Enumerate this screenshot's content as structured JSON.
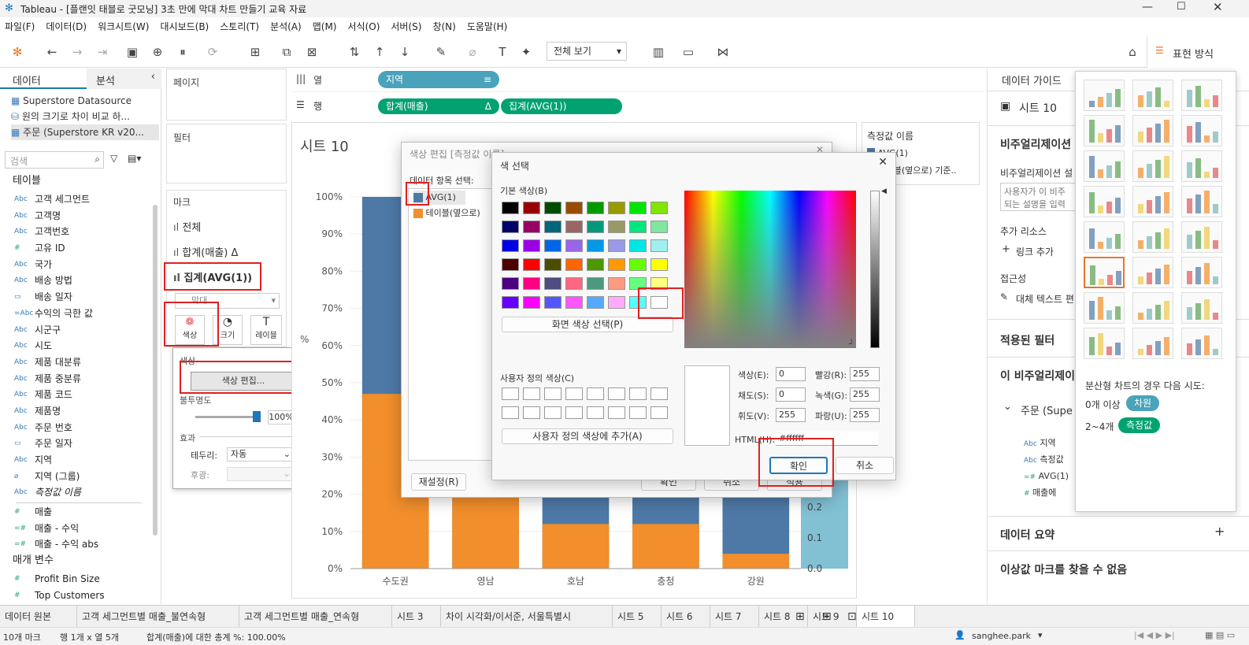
{
  "window": {
    "title": "Tableau - [플랜잇 태블로 굿모닝] 3초 만에 막대 차트 만들기 교육 자료"
  },
  "menu": [
    "파일(F)",
    "데이터(D)",
    "워크시트(W)",
    "대시보드(B)",
    "스토리(T)",
    "분석(A)",
    "맵(M)",
    "서식(O)",
    "서버(S)",
    "창(N)",
    "도움말(H)"
  ],
  "toolbar": {
    "view_dropdown": "전체 보기",
    "show_me_label": "표현 방식"
  },
  "left": {
    "tab_data": "데이터",
    "tab_analysis": "분석",
    "sources": [
      "Superstore Datasource",
      "원의 크기로 차이 비교 하...",
      "주문 (Superstore KR v20..."
    ],
    "search_placeholder": "검색",
    "tables_header": "테이블",
    "fields": [
      {
        "type": "Abc",
        "name": "고객 세그먼트"
      },
      {
        "type": "Abc",
        "name": "고객명"
      },
      {
        "type": "Abc",
        "name": "고객번호"
      },
      {
        "type": "#",
        "name": "고유 ID"
      },
      {
        "type": "Abc",
        "name": "국가"
      },
      {
        "type": "Abc",
        "name": "배송 방법"
      },
      {
        "type": "▭",
        "name": "배송 일자"
      },
      {
        "type": "=Abc",
        "name": "수익의 극한 값"
      },
      {
        "type": "Abc",
        "name": "시군구"
      },
      {
        "type": "Abc",
        "name": "시도"
      },
      {
        "type": "Abc",
        "name": "제품 대분류"
      },
      {
        "type": "Abc",
        "name": "제품 중분류"
      },
      {
        "type": "Abc",
        "name": "제품 코드"
      },
      {
        "type": "Abc",
        "name": "제품명"
      },
      {
        "type": "Abc",
        "name": "주문 번호"
      },
      {
        "type": "▭",
        "name": "주문 일자"
      },
      {
        "type": "Abc",
        "name": "지역"
      },
      {
        "type": "⌀",
        "name": "지역 (그룹)"
      },
      {
        "type": "Abc",
        "name": "측정값 이름"
      }
    ],
    "measures": [
      {
        "type": "#",
        "name": "매출"
      },
      {
        "type": "=#",
        "name": "매출 - 수익"
      },
      {
        "type": "=#",
        "name": "매출 - 수익 abs"
      }
    ],
    "params_header": "매개 변수",
    "params": [
      {
        "type": "#",
        "name": "Profit Bin Size"
      },
      {
        "type": "#",
        "name": "Top Customers"
      }
    ]
  },
  "cards": {
    "pages": "페이지",
    "filters": "필터",
    "marks": "마크",
    "marks_items": [
      "전체",
      "합계(매출) Δ",
      "집계(AVG(1))"
    ],
    "mark_type": "막대",
    "mark_buttons": [
      "색상",
      "크기",
      "레이블"
    ],
    "color_popup": {
      "section": "색상",
      "edit_button": "색상 편집...",
      "opacity_label": "불투명도",
      "opacity_value": "100%",
      "effects": "효과",
      "border_label": "테두리:",
      "border_value": "자동",
      "halo_label": "후광:"
    }
  },
  "shelves": {
    "columns_label": "열",
    "rows_label": "행",
    "columns_pill": "지역",
    "rows_pills": [
      "합계(매출)",
      "집계(AVG(1))"
    ]
  },
  "sheet": {
    "title": "시트 10"
  },
  "chart_data": {
    "type": "bar",
    "categories": [
      "수도권",
      "영남",
      "호남",
      "충청",
      "강원"
    ],
    "series": [
      {
        "name": "AVG(1)",
        "values": [
          1.0,
          1.0,
          1.0,
          1.0,
          1.0
        ]
      },
      {
        "name": "테이블(옆으로) 기준...",
        "values": [
          0.47,
          0.26,
          0.12,
          0.12,
          0.04
        ]
      }
    ],
    "ylim": [
      0,
      1
    ],
    "y_ticks": [
      "0%",
      "10%",
      "20%",
      "30%",
      "40%",
      "50%",
      "60%",
      "70%",
      "80%",
      "90%",
      "100%"
    ],
    "ylabel": "%",
    "right_ticks": [
      "0.0",
      "0.1",
      "0.2"
    ],
    "colors": {
      "blue": "#4e79a7",
      "orange": "#f28e2b",
      "axis_band": "#82c0d4"
    }
  },
  "legend": {
    "title": "측정값 이름",
    "items": [
      "AVG(1)",
      "테이블(옆으로) 기준.."
    ]
  },
  "edit_colors_dialog": {
    "title": "색상 편집 [측정값 이름]",
    "select_label": "데이터 항목 선택:",
    "items": [
      "AVG(1)",
      "테이블(옆으로)"
    ],
    "reset": "재설정(R)",
    "ok": "확인",
    "cancel": "취소",
    "apply": "적용"
  },
  "color_picker": {
    "title": "색 선택",
    "basic_label": "기본 색상(B)",
    "pick_screen": "화면 색상 선택(P)",
    "custom_label": "사용자 정의 색상(C)",
    "add_custom": "사용자 정의 색상에 추가(A)",
    "hue_label": "색상(E):",
    "hue": "0",
    "sat_label": "채도(S):",
    "sat": "0",
    "lum_label": "휘도(V):",
    "lum": "255",
    "red_label": "빨강(R):",
    "red": "255",
    "green_label": "녹색(G):",
    "green": "255",
    "blue_label": "파랑(U):",
    "blue": "255",
    "html_label": "HTML(H):",
    "html": "#ffffff",
    "ok": "확인",
    "cancel": "취소",
    "swatches": [
      "#000000",
      "#990000",
      "#004d00",
      "#994c00",
      "#009900",
      "#999900",
      "#00e600",
      "#80e600",
      "#000066",
      "#990066",
      "#00667a",
      "#996666",
      "#00997a",
      "#999966",
      "#00e680",
      "#80e6a0",
      "#0000e6",
      "#9900e6",
      "#0066e6",
      "#9966e6",
      "#0099e6",
      "#9999e6",
      "#00e6e6",
      "#a0f0f0",
      "#4d0000",
      "#ff0000",
      "#4d4d00",
      "#ff6600",
      "#4d9900",
      "#ff9900",
      "#66ff00",
      "#ffff00",
      "#4d0080",
      "#ff0080",
      "#4d4d80",
      "#ff6680",
      "#4d9980",
      "#ff9980",
      "#66ff80",
      "#ffff80",
      "#6600ff",
      "#ff00ff",
      "#5555ff",
      "#ff55ff",
      "#55aaff",
      "#ffaaff",
      "#55ffff",
      "#ffffff"
    ]
  },
  "right": {
    "data_guide": "데이터 가이드",
    "sheet": "시트 10",
    "viz_header": "비주얼리제이션",
    "viz_desc_label": "비주얼리제이션 설",
    "viz_desc_placeholder": "사용자가 이 비주 되는 설명을 입력",
    "resources": "추가 리소스",
    "add_link": "링크 추가",
    "accessibility": "접근성",
    "alt_text": "대체 텍스트 편",
    "applied_filters": "적용된 필터",
    "this_viz": "이 비주얼리제이",
    "source": "주문 (Supe",
    "viz_fields": [
      "지역",
      "측정값",
      "AVG(1)",
      "매출에"
    ],
    "data_summary": "데이터 요약",
    "outliers": "이상값 마크를 찾을 수 없음"
  },
  "show_me": {
    "hint": "분산형 차트의 경우 다음 시도:",
    "dims": "0개 이상",
    "dims_badge": "차원",
    "measures": "2~4개",
    "measures_badge": "측정값"
  },
  "bottom_tabs": [
    "데이터 원본",
    "고객 세그먼트별 매출_불연속형",
    "고객 세그먼트별 매출_연속형",
    "시트 3",
    "차이 시각화/이서준, 서울특별시",
    "시트 5",
    "시트 6",
    "시트 7",
    "시트 8",
    "시트 9",
    "시트 10"
  ],
  "status": {
    "marks": "10개 마크",
    "rows_cols": "행 1개 x 열 5개",
    "sum": "합계(매출)에 대한 총계 %: 100.00%",
    "user": "sanghee.park"
  }
}
